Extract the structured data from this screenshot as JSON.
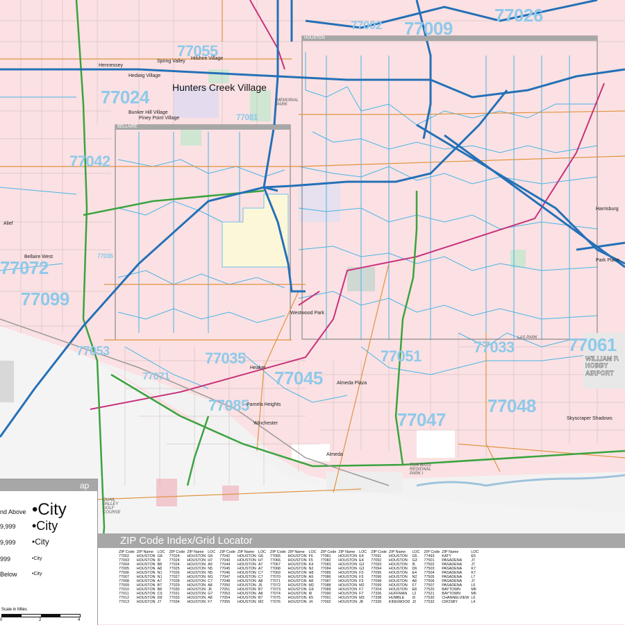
{
  "map": {
    "inset_labels": [
      "HOUSTON",
      "BELLAIRE"
    ],
    "zip_codes": [
      {
        "code": "77055",
        "id": "77055"
      },
      {
        "code": "77024",
        "id": "77024"
      },
      {
        "code": "77042",
        "id": "77042"
      },
      {
        "code": "77072",
        "id": "77072"
      },
      {
        "code": "77099",
        "id": "77099"
      },
      {
        "code": "77036",
        "id": "77036"
      },
      {
        "code": "77035",
        "id": "77035"
      },
      {
        "code": "77071",
        "id": "77071"
      },
      {
        "code": "77085",
        "id": "77085"
      },
      {
        "code": "77045",
        "id": "77045"
      },
      {
        "code": "77051",
        "id": "77051"
      },
      {
        "code": "77047",
        "id": "77047"
      },
      {
        "code": "77033",
        "id": "77033"
      },
      {
        "code": "77048",
        "id": "77048"
      },
      {
        "code": "77061",
        "id": "77061"
      },
      {
        "code": "77026",
        "id": "77026"
      },
      {
        "code": "77009",
        "id": "77009"
      },
      {
        "code": "77002",
        "id": "77002"
      },
      {
        "code": "77053",
        "id": "77053"
      },
      {
        "code": "77081",
        "id": "77081"
      }
    ],
    "places": [
      {
        "name": "Hunters Creek Village",
        "id": "hunters-creek"
      },
      {
        "name": "Spring Valley",
        "id": "spring-valley"
      },
      {
        "name": "Hilshire Village",
        "id": "hilshire"
      },
      {
        "name": "Hedwig Village",
        "id": "hedwig"
      },
      {
        "name": "Hennessey",
        "id": "hennessey"
      },
      {
        "name": "Bunker Hill Village",
        "id": "bunker-hill"
      },
      {
        "name": "Piney Point Village",
        "id": "piney-point"
      },
      {
        "name": "Alief",
        "id": "alief"
      },
      {
        "name": "Bellaire West",
        "id": "bellaire-west"
      },
      {
        "name": "Westwood Park",
        "id": "westwood-park"
      },
      {
        "name": "Heaker",
        "id": "heaker"
      },
      {
        "name": "Almeda Plaza",
        "id": "almeda-plaza"
      },
      {
        "name": "Pamela Heights",
        "id": "pamela-heights"
      },
      {
        "name": "Winchester",
        "id": "winchester"
      },
      {
        "name": "Almeda",
        "id": "almeda"
      },
      {
        "name": "Skyscraper Shadows",
        "id": "skyscraper-shadows"
      },
      {
        "name": "Park Place",
        "id": "park-place"
      },
      {
        "name": "Harrisburg",
        "id": "harrisburg"
      }
    ],
    "parks": [
      {
        "name": "MEMORIAL PARK",
        "id": "memorial-park"
      },
      {
        "name": "TOM BASS REGIONAL PARK I",
        "id": "tom-bass"
      },
      {
        "name": "LAS PARK",
        "id": "las-park"
      },
      {
        "name": "QUAIL VALLEY GOLF COURSE",
        "id": "quail-valley"
      }
    ],
    "airport": "WILLIAM P. HOBBY AIRPORT"
  },
  "legend": {
    "title": "ap",
    "rows": [
      {
        "label": "nd Above",
        "symbol": "•City",
        "size": 24
      },
      {
        "label": "9,999",
        "symbol": "•City",
        "size": 18
      },
      {
        "label": "9,999",
        "symbol": "•City",
        "size": 12
      },
      {
        "label": "999",
        "symbol": "•City",
        "size": 7
      },
      {
        "label": "Below",
        "symbol": "•City",
        "size": 7
      }
    ],
    "scale_label": "Scale in Miles",
    "scale_ticks": [
      "0",
      "2",
      "4"
    ]
  },
  "zip_index": {
    "title": "ZIP Code Index/Grid Locator",
    "headers": [
      "ZIP Code",
      "ZIP Name",
      "LOC"
    ],
    "columns": [
      [
        [
          "77002",
          "HOUSTON",
          "G8"
        ],
        [
          "77003",
          "HOUSTON",
          "I9"
        ],
        [
          "77004",
          "HOUSTON",
          "B8"
        ],
        [
          "77005",
          "HOUSTON",
          "A8"
        ],
        [
          "77006",
          "HOUSTON",
          "N1"
        ],
        [
          "77007",
          "HOUSTON",
          "N1"
        ],
        [
          "77008",
          "HOUSTON",
          "A7"
        ],
        [
          "77009",
          "HOUSTON",
          "B7"
        ],
        [
          "77010",
          "HOUSTON",
          "B8"
        ],
        [
          "77011",
          "HOUSTON",
          "C9"
        ],
        [
          "77012",
          "HOUSTON",
          "D8"
        ],
        [
          "77013",
          "HOUSTON",
          "J7"
        ]
      ],
      [
        [
          "77024",
          "HOUSTON",
          "G6"
        ],
        [
          "77024",
          "HOUSTON",
          "H7"
        ],
        [
          "77024",
          "HOUSTON",
          "A9"
        ],
        [
          "77025",
          "HOUSTON",
          "N5"
        ],
        [
          "77026",
          "HOUSTON",
          "N5"
        ],
        [
          "77027",
          "HOUSTON",
          "M1"
        ],
        [
          "77028",
          "HOUSTON",
          "C7"
        ],
        [
          "77029",
          "HOUSTON",
          "A8"
        ],
        [
          "77030",
          "HOUSTON",
          "J6"
        ],
        [
          "77031",
          "HOUSTON",
          "G7"
        ],
        [
          "77033",
          "HOUSTON",
          "A8"
        ],
        [
          "77034",
          "HOUSTON",
          "F7"
        ]
      ],
      [
        [
          "77042",
          "HOUSTON",
          "G6"
        ],
        [
          "77043",
          "HOUSTON",
          "H7"
        ],
        [
          "77044",
          "HOUSTON",
          "A7"
        ],
        [
          "77045",
          "HOUSTON",
          "A7"
        ],
        [
          "77046",
          "HOUSTON",
          "C7"
        ],
        [
          "77047",
          "HOUSTON",
          "C7"
        ],
        [
          "77048",
          "HOUSTON",
          "A8"
        ],
        [
          "77050",
          "HOUSTON",
          "J6"
        ],
        [
          "77051",
          "HOUSTON",
          "B7"
        ],
        [
          "77053",
          "HOUSTON",
          "A8"
        ],
        [
          "77054",
          "HOUSTON",
          "B7"
        ],
        [
          "77055",
          "HOUSTON",
          "M2"
        ]
      ],
      [
        [
          "77065",
          "HOUSTON",
          "F6"
        ],
        [
          "77066",
          "HOUSTON",
          "F5"
        ],
        [
          "77067",
          "HOUSTON",
          "K4"
        ],
        [
          "77068",
          "HOUSTON",
          "N2"
        ],
        [
          "77069",
          "HOUSTON",
          "H8"
        ],
        [
          "77070",
          "HOUSTON",
          "A9"
        ],
        [
          "77071",
          "HOUSTON",
          "A8"
        ],
        [
          "77072",
          "HOUSTON",
          "M2"
        ],
        [
          "77073",
          "HOUSTON",
          "G9"
        ],
        [
          "77074",
          "HOUSTON",
          "I8"
        ],
        [
          "77075",
          "HOUSTON",
          "K5"
        ],
        [
          "77076",
          "HOUSTON",
          "J4"
        ]
      ],
      [
        [
          "77081",
          "HOUSTON",
          "E4"
        ],
        [
          "77082",
          "HOUSTON",
          "E4"
        ],
        [
          "77083",
          "HOUSTON",
          "G3"
        ],
        [
          "77084",
          "HOUSTON",
          "G3"
        ],
        [
          "77085",
          "HOUSTON",
          "F3"
        ],
        [
          "77086",
          "HOUSTON",
          "F3"
        ],
        [
          "77087",
          "HOUSTON",
          "F3"
        ],
        [
          "77088",
          "HOUSTON",
          "M2"
        ],
        [
          "77089",
          "HOUSTON",
          "F7"
        ],
        [
          "77090",
          "HOUSTON",
          "F7"
        ],
        [
          "77091",
          "HOUSTON",
          "M3"
        ],
        [
          "77092",
          "HOUSTON",
          "J8"
        ]
      ],
      [
        [
          "77091",
          "HOUSTON",
          "G5"
        ],
        [
          "77092",
          "HOUSTON",
          "G3"
        ],
        [
          "77093",
          "HOUSTON",
          "I5"
        ],
        [
          "77094",
          "HOUSTON",
          "D6"
        ],
        [
          "77095",
          "HOUSTON",
          "E4"
        ],
        [
          "77096",
          "HOUSTON",
          "N2"
        ],
        [
          "77098",
          "HOUSTON",
          "A8"
        ],
        [
          "77099",
          "HOUSTON",
          "F7"
        ],
        [
          "77204",
          "HOUSTON",
          "E8"
        ],
        [
          "77336",
          "HUFFMAN",
          "L2"
        ],
        [
          "77338",
          "HUMBLE",
          "I3"
        ],
        [
          "77339",
          "KINGWOOD",
          "J2"
        ]
      ],
      [
        [
          "77493",
          "KATY",
          "E5"
        ],
        [
          "77501",
          "PASADENA",
          "J7"
        ],
        [
          "77502",
          "PASADENA",
          "J7"
        ],
        [
          "77503",
          "PASADENA",
          "K7"
        ],
        [
          "77504",
          "PASADENA",
          "K7"
        ],
        [
          "77505",
          "PASADENA",
          "L7"
        ],
        [
          "77506",
          "PASADENA",
          "J7"
        ],
        [
          "77507",
          "PASADENA",
          "L5"
        ],
        [
          "77520",
          "BAYTOWN",
          "M6"
        ],
        [
          "77521",
          "BAYTOWN",
          "M5"
        ],
        [
          "77530",
          "CHANNELVIEW",
          "L6"
        ],
        [
          "77532",
          "CROSBY",
          "L4"
        ]
      ]
    ]
  }
}
